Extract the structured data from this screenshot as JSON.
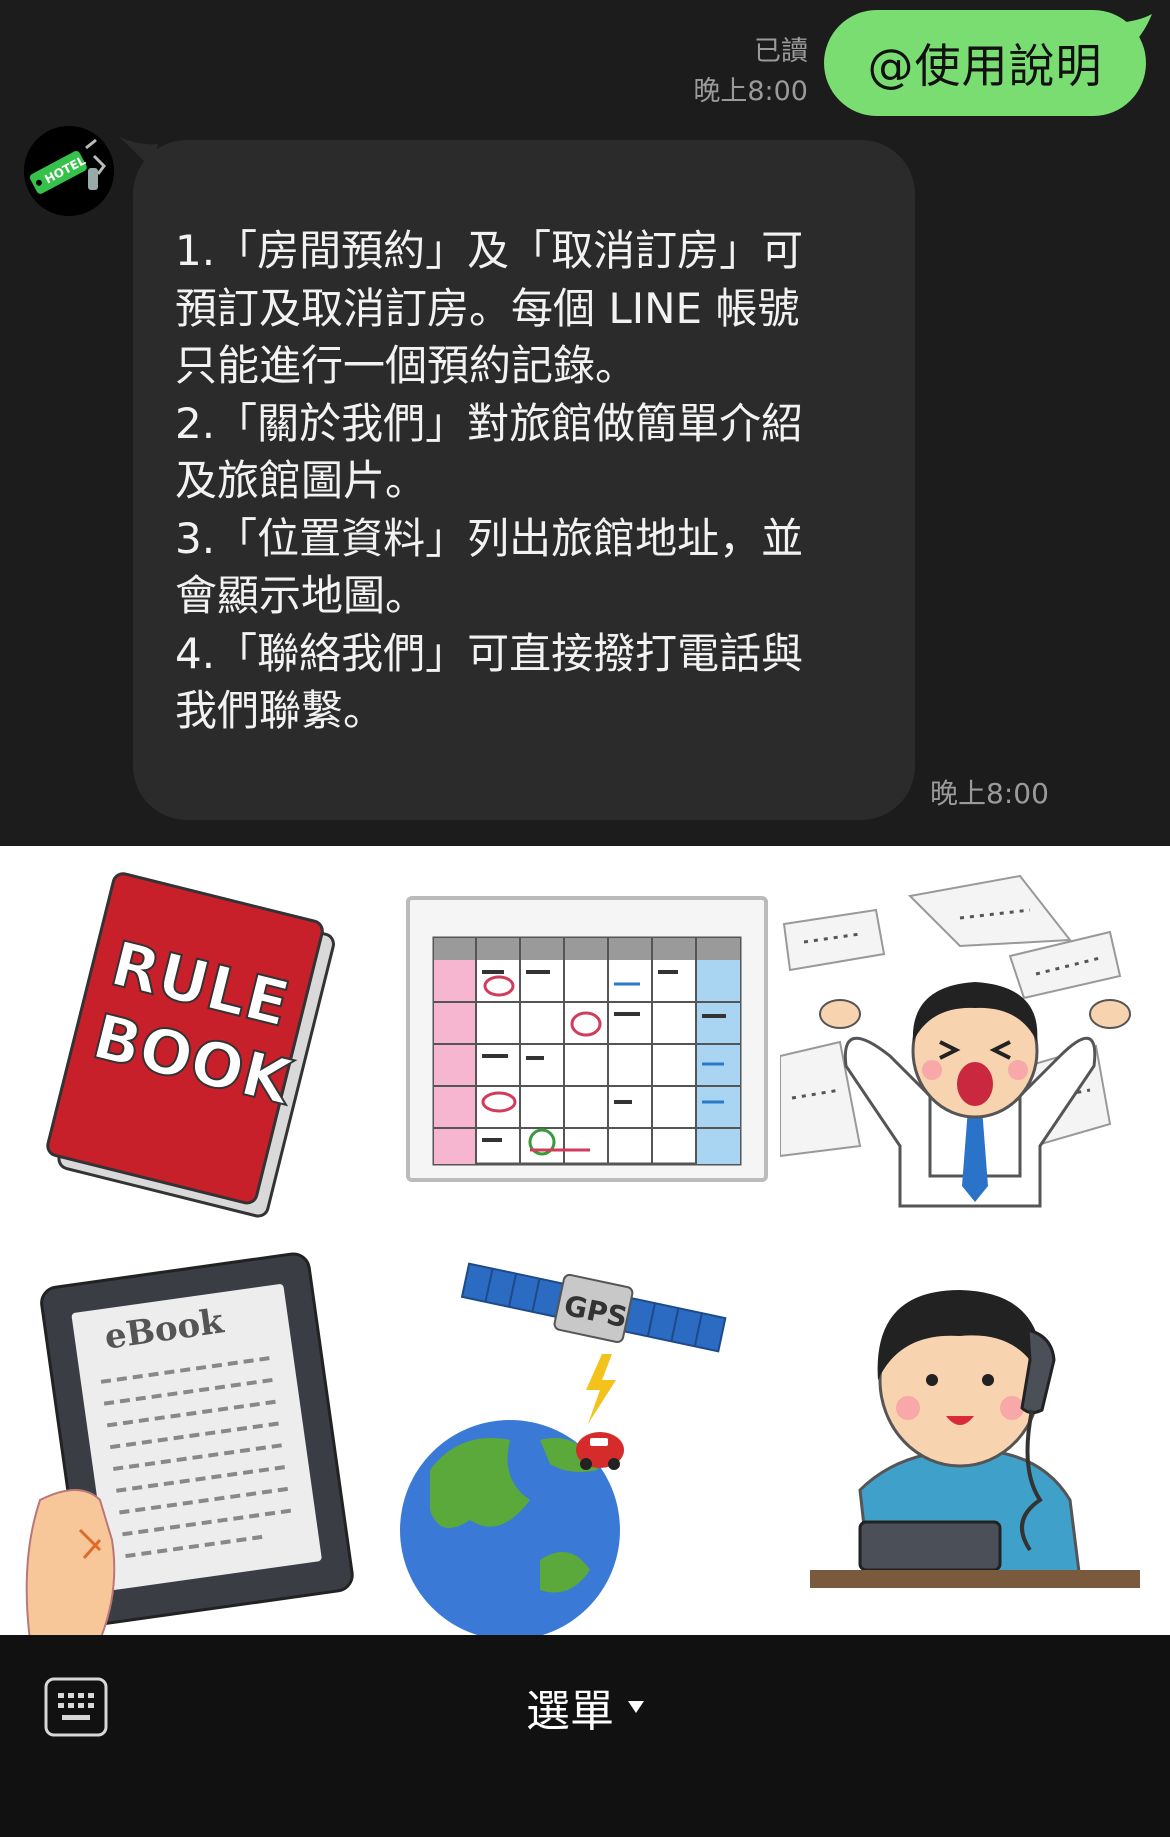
{
  "chat": {
    "sent": {
      "read_label": "已讀",
      "time": "晚上8:00",
      "text": "@使用說明"
    },
    "received": {
      "lines": [
        "1.「房間預約」及「取消訂房」可",
        "預訂及取消訂房。每個 LINE 帳號",
        "只能進行一個預約記錄。",
        "2.「關於我們」對旅館做簡單介紹",
        "及旅館圖片。",
        "3.「位置資料」列出旅館地址，並",
        "會顯示地圖。",
        "4.「聯絡我們」可直接撥打電話與",
        "我們聯繫。"
      ],
      "time": "晚上8:00",
      "avatar_tag": "HOTEL"
    }
  },
  "rich_menu": {
    "tiles": [
      {
        "name": "rulebook",
        "label": "RULE BOOK"
      },
      {
        "name": "calendar",
        "label": ""
      },
      {
        "name": "overwhelmed-man",
        "label": ""
      },
      {
        "name": "ebook",
        "label": "eBook"
      },
      {
        "name": "gps-globe",
        "label": "GPS"
      },
      {
        "name": "phone-call",
        "label": ""
      }
    ]
  },
  "bottom_bar": {
    "menu_label": "選單",
    "keyboard_icon": "keyboard-icon",
    "caret_icon": "caret-down-icon"
  },
  "colors": {
    "sent_bubble": "#79dd72",
    "received_bubble": "#2b2b2b",
    "background": "#1c1c1c"
  }
}
